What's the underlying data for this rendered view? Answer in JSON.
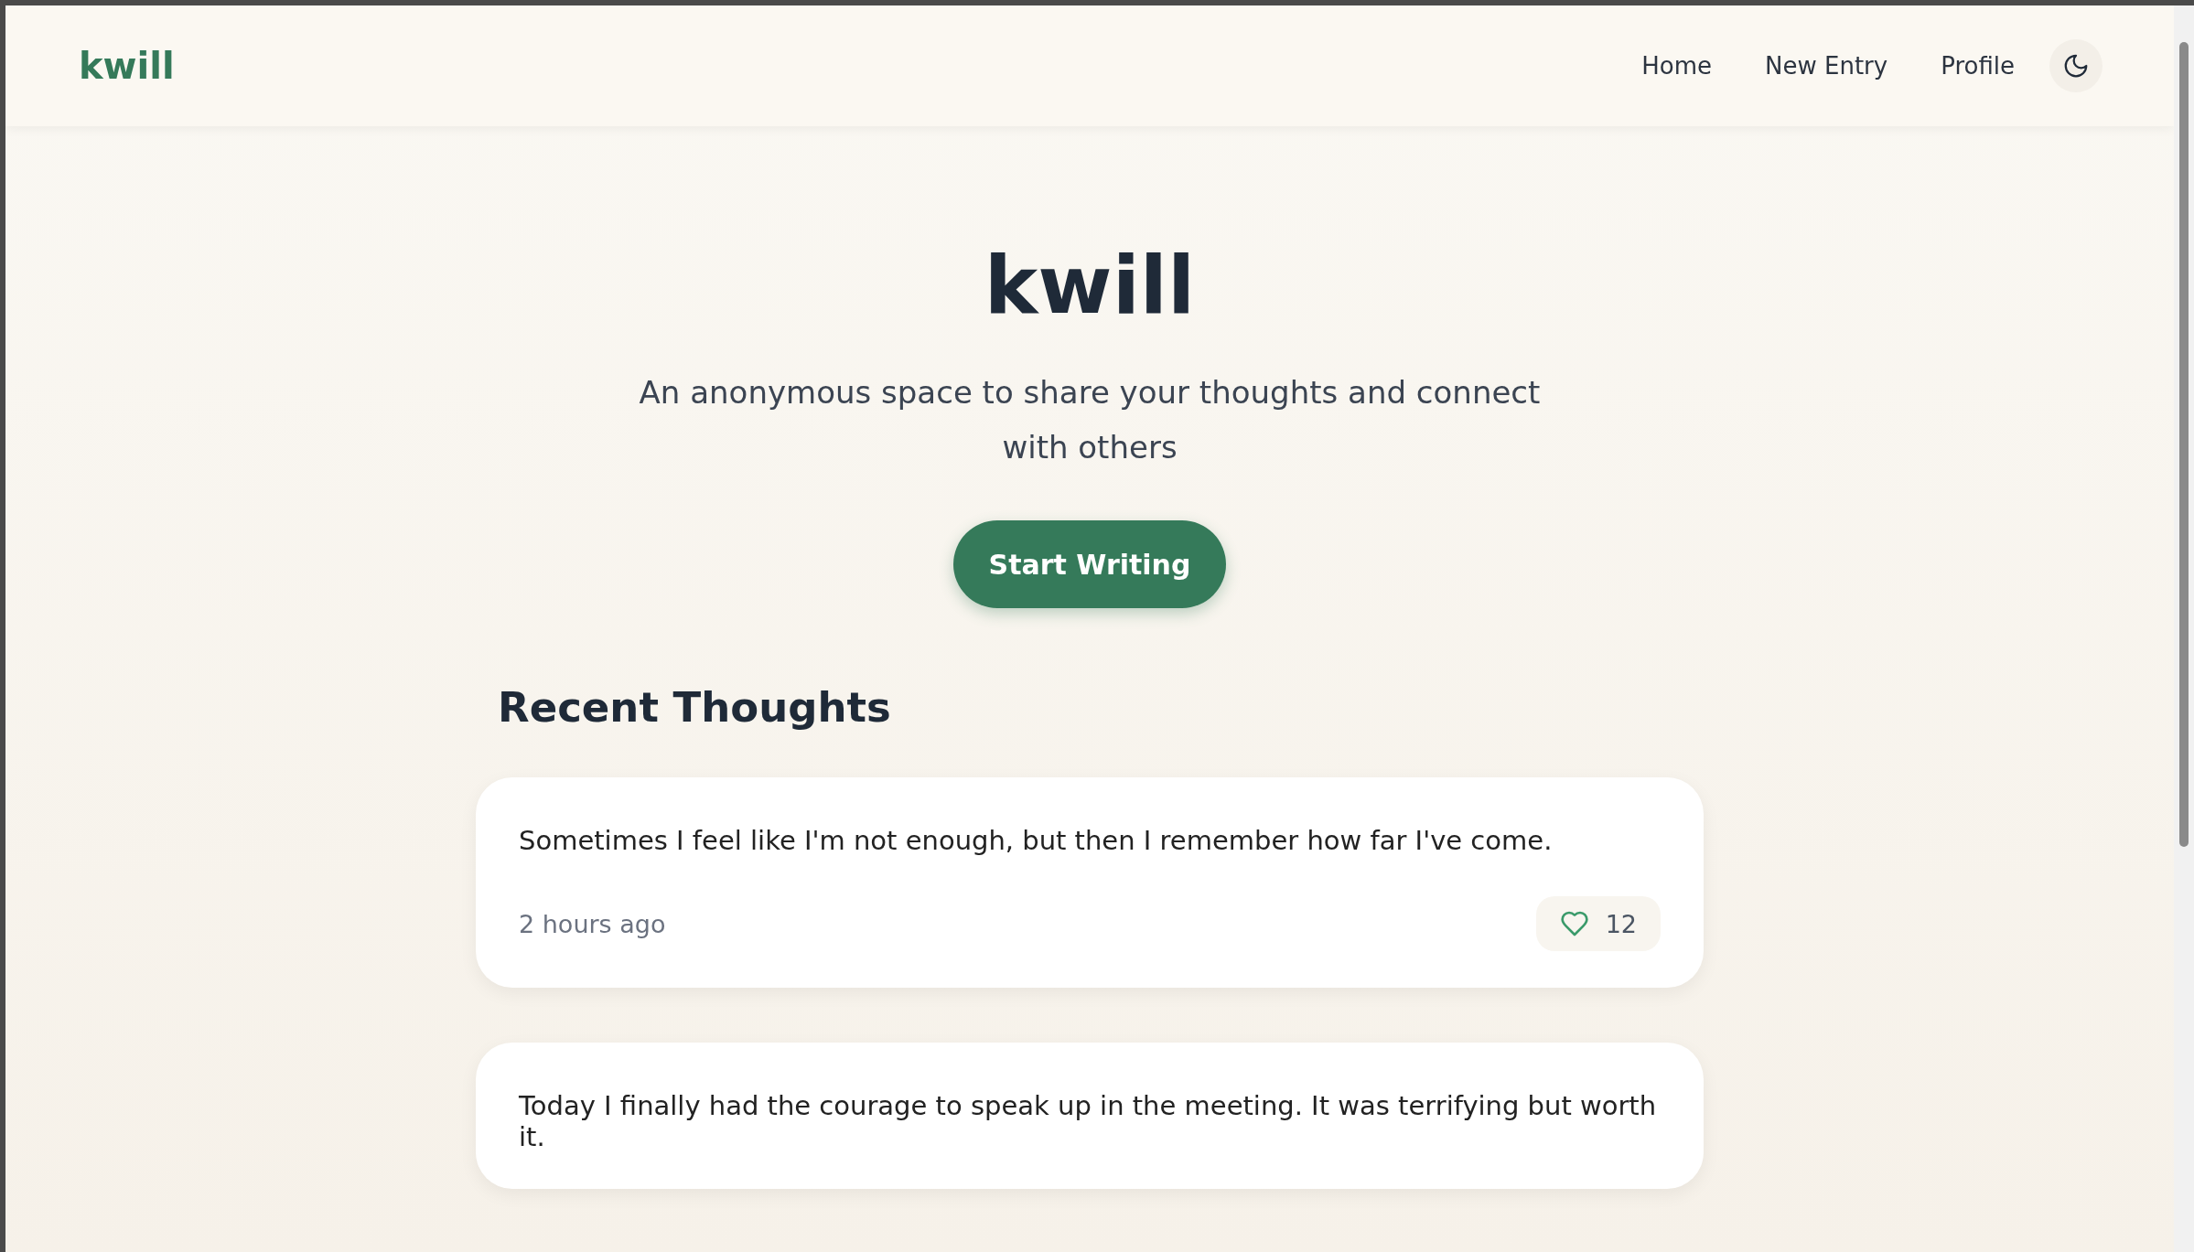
{
  "nav": {
    "logo": "kwill",
    "links": [
      {
        "label": "Home"
      },
      {
        "label": "New Entry"
      },
      {
        "label": "Profile"
      }
    ]
  },
  "hero": {
    "title": "kwill",
    "subtitle": "An anonymous space to share your thoughts and connect with others",
    "button": "Start Writing"
  },
  "section_title": "Recent Thoughts",
  "posts": [
    {
      "text": "Sometimes I feel like I'm not enough, but then I remember how far I've come.",
      "time": "2 hours ago",
      "likes": "12"
    },
    {
      "text": "Today I finally had the courage to speak up in the meeting. It was terrifying but worth it."
    }
  ]
}
